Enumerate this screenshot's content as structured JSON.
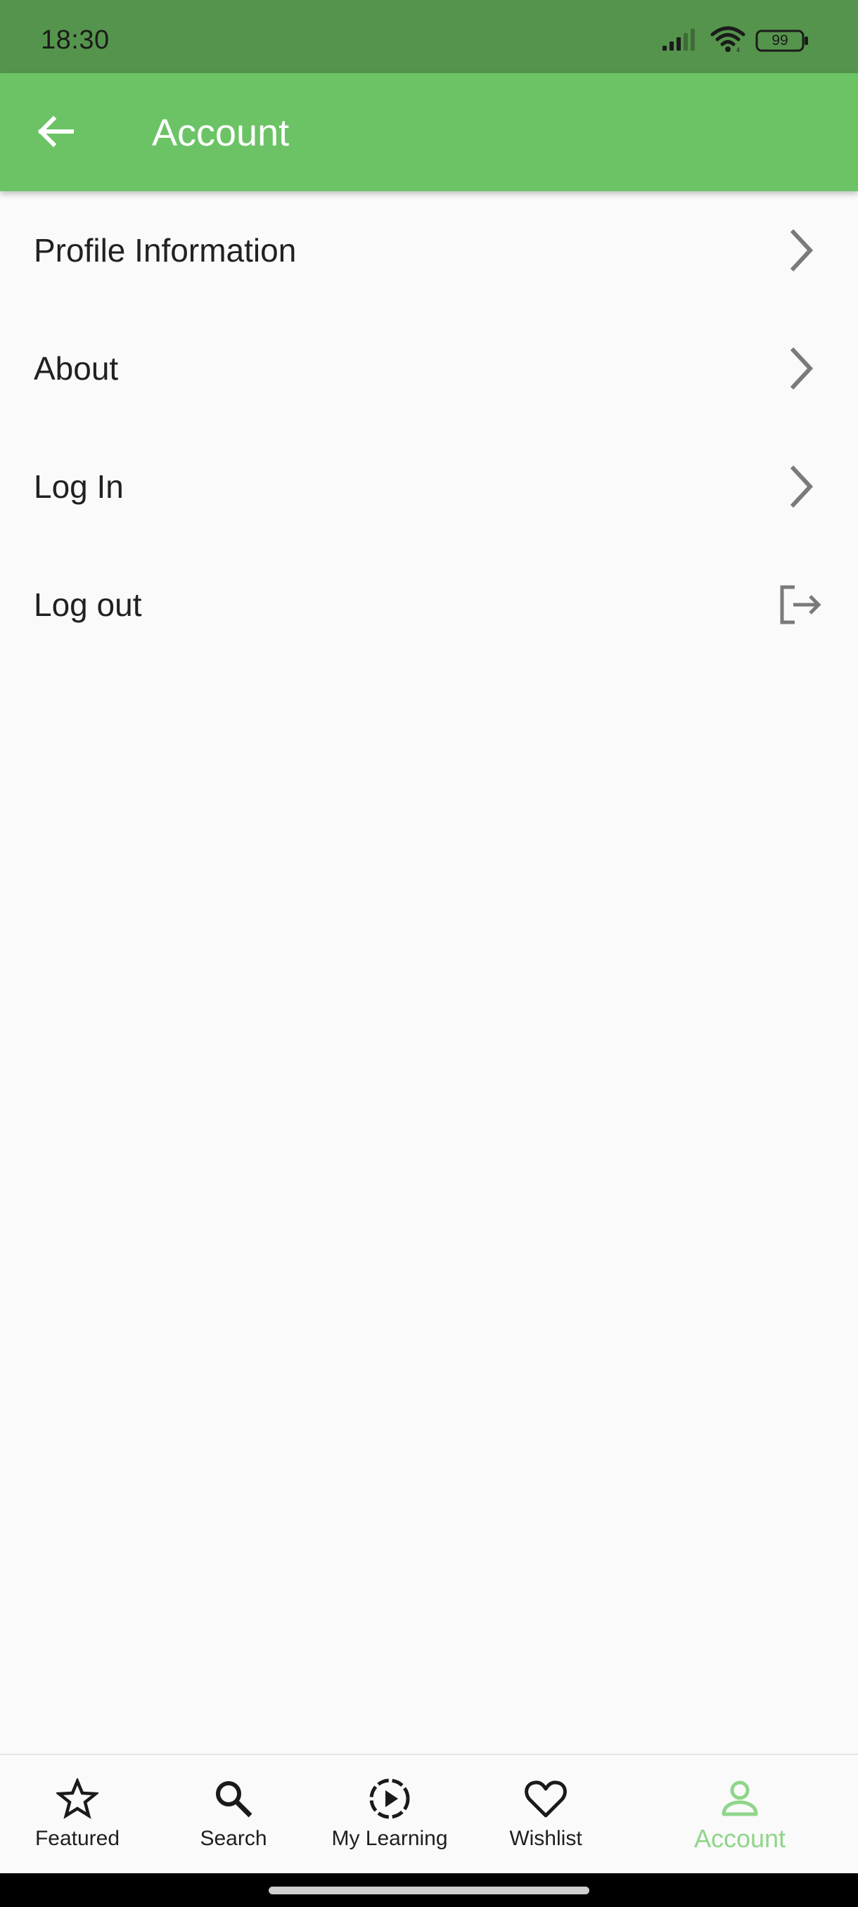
{
  "status_bar": {
    "time": "18:30",
    "battery": "99",
    "icons": [
      "signal-icon",
      "wifi-icon",
      "battery-icon"
    ]
  },
  "app_bar": {
    "title": "Account",
    "back_icon": "arrow-back-icon"
  },
  "menu": [
    {
      "label": "Profile Information",
      "icon": "chevron-right-icon"
    },
    {
      "label": "About",
      "icon": "chevron-right-icon"
    },
    {
      "label": "Log In",
      "icon": "chevron-right-icon"
    },
    {
      "label": "Log out",
      "icon": "logout-icon"
    }
  ],
  "bottom_nav": {
    "items": [
      {
        "label": "Featured",
        "icon": "star-outline-icon"
      },
      {
        "label": "Search",
        "icon": "search-icon"
      },
      {
        "label": "My Learning",
        "icon": "play-circle-icon"
      },
      {
        "label": "Wishlist",
        "icon": "heart-outline-icon"
      },
      {
        "label": "Account",
        "icon": "person-outline-icon"
      }
    ],
    "active": "Account"
  },
  "colors": {
    "status_bar": "#55944c",
    "app_bar": "#6cc366",
    "active_nav": "#8fd58a",
    "background": "#fafafa"
  }
}
